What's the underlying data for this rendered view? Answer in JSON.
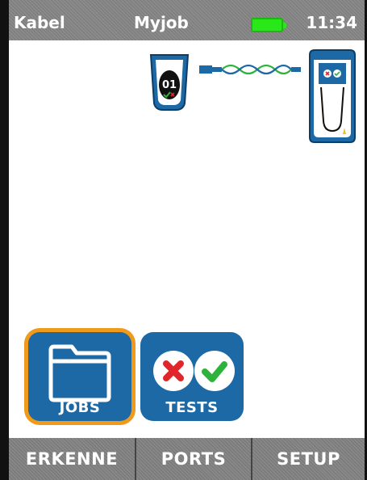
{
  "statusbar": {
    "left_label": "Kabel",
    "job_name": "Myjob",
    "battery_icon": "battery-full-icon",
    "battery_color": "#29e81a",
    "time": "11:34"
  },
  "diagram": {
    "remote_id": "01",
    "cable_icon": "twisted-pair-cable-icon",
    "tester_icon": "tester-device-icon"
  },
  "tiles": [
    {
      "label": "JOBS",
      "icon": "folder-icon",
      "selected": true
    },
    {
      "label": "TESTS",
      "icon": "fail-pass-icon",
      "selected": false
    }
  ],
  "softkeys": [
    {
      "label": "ERKENNE"
    },
    {
      "label": "PORTS"
    },
    {
      "label": "SETUP"
    }
  ],
  "colors": {
    "accent_blue": "#1d69a6",
    "selection_orange": "#f09a1c",
    "fail_red": "#e0262a",
    "pass_green": "#2db33b"
  }
}
